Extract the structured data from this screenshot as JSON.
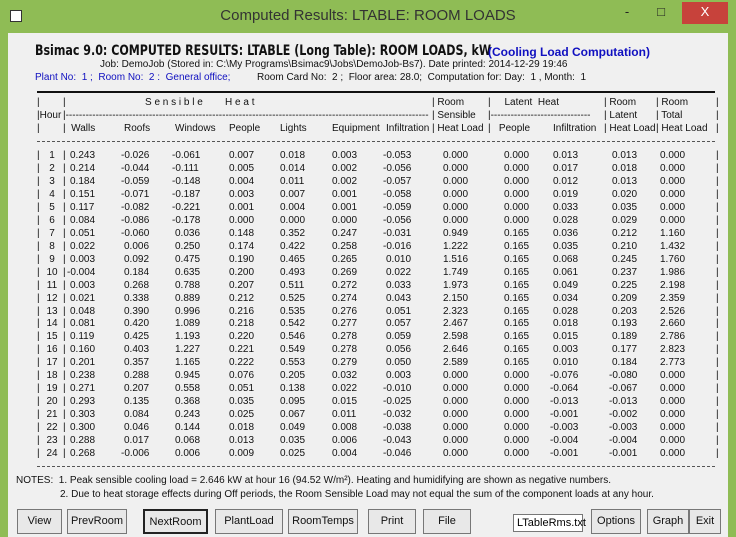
{
  "window": {
    "title": "Computed  Results:  LTABLE: ROOM LOADS",
    "minimize": "-",
    "maximize": "□",
    "close": "X"
  },
  "report": {
    "heading": "Bsimac 9.0: COMPUTED RESULTS: LTABLE (Long Table): ROOM LOADS, kW",
    "mode": "(Cooling Load Computation)",
    "job_line": "Job: DemoJob (Stored in: C:\\My Programs\\Bsimac9\\Jobs\\DemoJob-Bs7). Date printed: 2014-12-29 19:46",
    "plant_room": "Plant No:  1 ;  Room No:  2 :  General office;",
    "room_info": "Room Card No:  2 ;  Floor area: 28.0;  Computation for: Day:  1 , Month:  1"
  },
  "table": {
    "header_rows": [
      [
        "|",
        "|",
        "S e n s i b l e        H e a t",
        "",
        "",
        "",
        "",
        "",
        "| Room",
        "|     Latent  Heat",
        "",
        "| Room",
        "| Room",
        "|"
      ],
      [
        "|Hour",
        "|-------------------------------------------------------------------------------------------------------------",
        "",
        "",
        "",
        "",
        "",
        "",
        "| Sensible",
        "|------------------------------",
        "",
        "| Latent",
        "| Total",
        "|"
      ],
      [
        "|",
        "|  Walls",
        "Roofs",
        "Windows",
        "People",
        "Lights",
        "Equipment",
        "Infiltration",
        "| Heat Load",
        "|   People",
        "Infiltration",
        "| Heat Load",
        "| Heat Load",
        "|"
      ]
    ],
    "rows": [
      [
        "1",
        "0.243",
        "-0.026",
        "-0.061",
        "0.007",
        "0.018",
        "0.003",
        "-0.053",
        "0.000",
        "0.000",
        "0.013",
        "0.013",
        "0.000"
      ],
      [
        "2",
        "0.214",
        "-0.044",
        "-0.111",
        "0.005",
        "0.014",
        "0.002",
        "-0.056",
        "0.000",
        "0.000",
        "0.017",
        "0.018",
        "0.000"
      ],
      [
        "3",
        "0.184",
        "-0.059",
        "-0.148",
        "0.004",
        "0.011",
        "0.002",
        "-0.057",
        "0.000",
        "0.000",
        "0.012",
        "0.013",
        "0.000"
      ],
      [
        "4",
        "0.151",
        "-0.071",
        "-0.187",
        "0.003",
        "0.007",
        "0.001",
        "-0.058",
        "0.000",
        "0.000",
        "0.019",
        "0.020",
        "0.000"
      ],
      [
        "5",
        "0.117",
        "-0.082",
        "-0.221",
        "0.001",
        "0.004",
        "0.001",
        "-0.059",
        "0.000",
        "0.000",
        "0.033",
        "0.035",
        "0.000"
      ],
      [
        "6",
        "0.084",
        "-0.086",
        "-0.178",
        "0.000",
        "0.000",
        "0.000",
        "-0.056",
        "0.000",
        "0.000",
        "0.028",
        "0.029",
        "0.000"
      ],
      [
        "7",
        "0.051",
        "-0.060",
        "0.036",
        "0.148",
        "0.352",
        "0.247",
        "-0.031",
        "0.949",
        "0.165",
        "0.036",
        "0.212",
        "1.160"
      ],
      [
        "8",
        "0.022",
        "0.006",
        "0.250",
        "0.174",
        "0.422",
        "0.258",
        "-0.016",
        "1.222",
        "0.165",
        "0.035",
        "0.210",
        "1.432"
      ],
      [
        "9",
        "0.003",
        "0.092",
        "0.475",
        "0.190",
        "0.465",
        "0.265",
        "0.010",
        "1.516",
        "0.165",
        "0.068",
        "0.245",
        "1.760"
      ],
      [
        "10",
        "-0.004",
        "0.184",
        "0.635",
        "0.200",
        "0.493",
        "0.269",
        "0.022",
        "1.749",
        "0.165",
        "0.061",
        "0.237",
        "1.986"
      ],
      [
        "11",
        "0.003",
        "0.268",
        "0.788",
        "0.207",
        "0.511",
        "0.272",
        "0.033",
        "1.973",
        "0.165",
        "0.049",
        "0.225",
        "2.198"
      ],
      [
        "12",
        "0.021",
        "0.338",
        "0.889",
        "0.212",
        "0.525",
        "0.274",
        "0.043",
        "2.150",
        "0.165",
        "0.034",
        "0.209",
        "2.359"
      ],
      [
        "13",
        "0.048",
        "0.390",
        "0.996",
        "0.216",
        "0.535",
        "0.276",
        "0.051",
        "2.323",
        "0.165",
        "0.028",
        "0.203",
        "2.526"
      ],
      [
        "14",
        "0.081",
        "0.420",
        "1.089",
        "0.218",
        "0.542",
        "0.277",
        "0.057",
        "2.467",
        "0.165",
        "0.018",
        "0.193",
        "2.660"
      ],
      [
        "15",
        "0.119",
        "0.425",
        "1.193",
        "0.220",
        "0.546",
        "0.278",
        "0.059",
        "2.598",
        "0.165",
        "0.015",
        "0.189",
        "2.786"
      ],
      [
        "16",
        "0.160",
        "0.403",
        "1.227",
        "0.221",
        "0.549",
        "0.278",
        "0.056",
        "2.646",
        "0.165",
        "0.003",
        "0.177",
        "2.823"
      ],
      [
        "17",
        "0.201",
        "0.357",
        "1.165",
        "0.222",
        "0.553",
        "0.279",
        "0.050",
        "2.589",
        "0.165",
        "0.010",
        "0.184",
        "2.773"
      ],
      [
        "18",
        "0.238",
        "0.288",
        "0.945",
        "0.076",
        "0.205",
        "0.032",
        "0.003",
        "0.000",
        "0.000",
        "-0.076",
        "-0.080",
        "0.000"
      ],
      [
        "19",
        "0.271",
        "0.207",
        "0.558",
        "0.051",
        "0.138",
        "0.022",
        "-0.010",
        "0.000",
        "0.000",
        "-0.064",
        "-0.067",
        "0.000"
      ],
      [
        "20",
        "0.293",
        "0.135",
        "0.368",
        "0.035",
        "0.095",
        "0.015",
        "-0.025",
        "0.000",
        "0.000",
        "-0.013",
        "-0.013",
        "0.000"
      ],
      [
        "21",
        "0.303",
        "0.084",
        "0.243",
        "0.025",
        "0.067",
        "0.011",
        "-0.032",
        "0.000",
        "0.000",
        "-0.001",
        "-0.002",
        "0.000"
      ],
      [
        "22",
        "0.300",
        "0.046",
        "0.144",
        "0.018",
        "0.049",
        "0.008",
        "-0.038",
        "0.000",
        "0.000",
        "-0.003",
        "-0.003",
        "0.000"
      ],
      [
        "23",
        "0.288",
        "0.017",
        "0.068",
        "0.013",
        "0.035",
        "0.006",
        "-0.043",
        "0.000",
        "0.000",
        "-0.004",
        "-0.004",
        "0.000"
      ],
      [
        "24",
        "0.268",
        "-0.006",
        "0.006",
        "0.009",
        "0.025",
        "0.004",
        "-0.046",
        "0.000",
        "0.000",
        "-0.001",
        "-0.001",
        "0.000"
      ]
    ]
  },
  "notes": {
    "line1": "NOTES:  1. Peak sensible cooling load = 2.646 kW at hour 16 (94.52 W/m²). Heating and humidifying are shown as negative numbers.",
    "line2": "2. Due to heat storage effects during Off periods, the Room Sensible Load may not equal the sum of the component loads at any hour."
  },
  "buttons": [
    "View",
    "PrevRoom",
    "NextRoom",
    "PlantLoad",
    "RoomTemps",
    "Print",
    "File",
    "Options",
    "Graph",
    "Exit"
  ],
  "output_file": "LTableRms.txt",
  "colors": {
    "frame": "#8fbc55",
    "blue_text": "#1010c0",
    "close": "#c7423b"
  }
}
